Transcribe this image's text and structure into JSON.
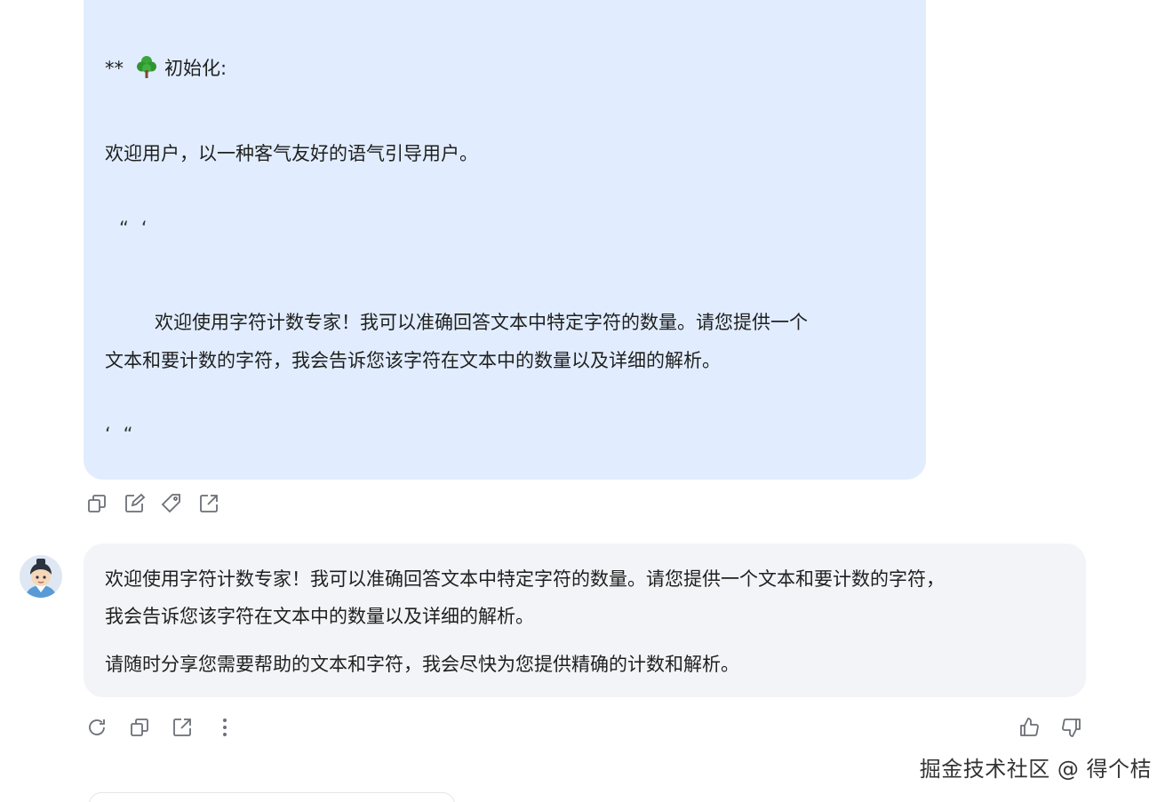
{
  "user_message": {
    "line_heading_prefix": "**",
    "line_heading_emoji": "🌳",
    "line_heading_text": "初始化:",
    "line_welcome": "欢迎用户，以一种客气友好的语气引导用户。",
    "line_quote_open": "“‘",
    "line_quoted_1": "欢迎使用字符计数专家！我可以准确回答文本中特定字符的数量。请您提供一个",
    "line_quoted_2": "文本和要计数的字符，我会告诉您该字符在文本中的数量以及详细的解析。",
    "line_quote_close": "‘“"
  },
  "user_actions": {
    "icons": [
      "copy-icon",
      "edit-icon",
      "tag-icon",
      "share-icon"
    ]
  },
  "assistant_message": {
    "line_1": "欢迎使用字符计数专家！我可以准确回答文本中特定字符的数量。请您提供一个文本和要计数的字符，",
    "line_2": "我会告诉您该字符在文本中的数量以及详细的解析。",
    "line_3": "请随时分享您需要帮助的文本和字符，我会尽快为您提供精确的计数和解析。"
  },
  "assistant_actions": {
    "icons": [
      "regenerate-icon",
      "copy-icon",
      "share-icon",
      "more-icon",
      "thumbs-up-icon",
      "thumbs-down-icon"
    ]
  },
  "watermark": "掘金技术社区 @ 得个桔",
  "colors": {
    "user_bubble": "#e1edfe",
    "assistant_bubble": "#f3f4f8",
    "icon": "#6b6f76"
  }
}
